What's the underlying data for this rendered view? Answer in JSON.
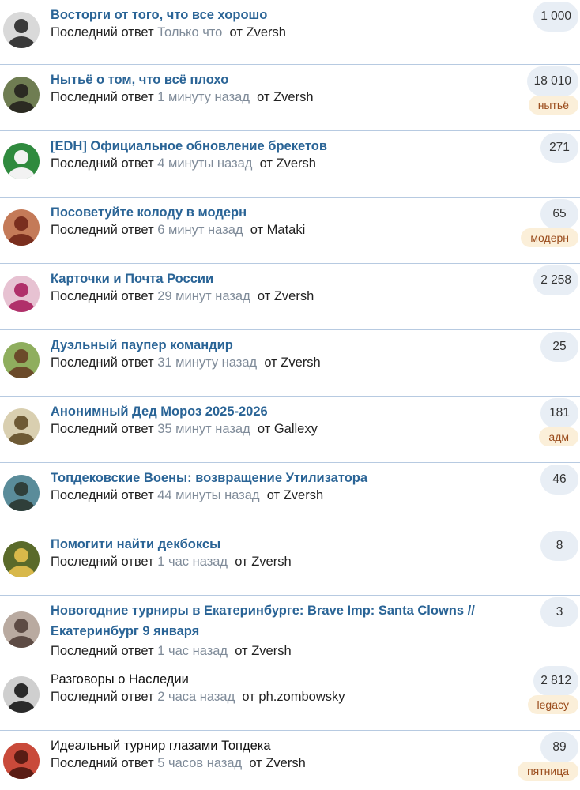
{
  "topics": [
    {
      "title": "Восторги от того, что все хорошо",
      "reply_prefix": "Последний ответ",
      "time": "Только что",
      "by": "от",
      "author": "Zversh",
      "count": "1 000",
      "tag": null,
      "bold": true,
      "avatar": "avatar-a"
    },
    {
      "title": "Нытьё о том, что всё плохо",
      "reply_prefix": "Последний ответ",
      "time": "1 минуту назад",
      "by": "от",
      "author": "Zversh",
      "count": "18 010",
      "tag": "нытьё",
      "bold": true,
      "avatar": "avatar-b"
    },
    {
      "title": "[EDH] Официальное обновление брекетов",
      "reply_prefix": "Последний ответ",
      "time": "4 минуты назад",
      "by": "от",
      "author": "Zversh",
      "count": "271",
      "tag": null,
      "bold": true,
      "avatar": "avatar-c"
    },
    {
      "title": "Посоветуйте колоду в модерн",
      "reply_prefix": "Последний ответ",
      "time": "6 минут назад",
      "by": "от",
      "author": "Mataki",
      "count": "65",
      "tag": "модерн",
      "bold": true,
      "avatar": "avatar-d"
    },
    {
      "title": "Карточки и Почта России",
      "reply_prefix": "Последний ответ",
      "time": "29 минут назад",
      "by": "от",
      "author": "Zversh",
      "count": "2 258",
      "tag": null,
      "bold": true,
      "avatar": "avatar-e"
    },
    {
      "title": "Дуэльный паупер командир",
      "reply_prefix": "Последний ответ",
      "time": "31 минуту назад",
      "by": "от",
      "author": "Zversh",
      "count": "25",
      "tag": null,
      "bold": true,
      "avatar": "avatar-f"
    },
    {
      "title": "Анонимный Дед Мороз 2025-2026",
      "reply_prefix": "Последний ответ",
      "time": "35 минут назад",
      "by": "от",
      "author": "Gallexy",
      "count": "181",
      "tag": "адм",
      "bold": true,
      "avatar": "avatar-g"
    },
    {
      "title": "Топдековские Воены: возвращение Утилизатора",
      "reply_prefix": "Последний ответ",
      "time": "44 минуты назад",
      "by": "от",
      "author": "Zversh",
      "count": "46",
      "tag": null,
      "bold": true,
      "avatar": "avatar-h"
    },
    {
      "title": "Помогити найти декбоксы",
      "reply_prefix": "Последний ответ",
      "time": "1 час назад",
      "by": "от",
      "author": "Zversh",
      "count": "8",
      "tag": null,
      "bold": true,
      "avatar": "avatar-i"
    },
    {
      "title": "Новогодние турниры в Екатеринбурге: Brave Imp: Santa Clowns // Екатеринбург 9 января",
      "reply_prefix": "Последний ответ",
      "time": "1 час назад",
      "by": "от",
      "author": "Zversh",
      "count": "3",
      "tag": null,
      "bold": true,
      "avatar": "avatar-j"
    },
    {
      "title": "Разговоры о Наследии",
      "reply_prefix": "Последний ответ",
      "time": "2 часа назад",
      "by": "от",
      "author": "ph.zombowsky",
      "count": "2 812",
      "tag": "legacy",
      "bold": false,
      "avatar": "avatar-k"
    },
    {
      "title": "Идеальный турнир глазами Топдека",
      "reply_prefix": "Последний ответ",
      "time": "5 часов назад",
      "by": "от",
      "author": "Zversh",
      "count": "89",
      "tag": "пятница",
      "bold": false,
      "avatar": "avatar-l"
    }
  ],
  "avatar_colors": {
    "avatar-a": [
      "#d9d9d9",
      "#3a3a3a"
    ],
    "avatar-b": [
      "#6f7d52",
      "#2b2a22"
    ],
    "avatar-c": [
      "#2f8a3e",
      "#f2f2f2"
    ],
    "avatar-d": [
      "#c47a58",
      "#7a2e1e"
    ],
    "avatar-e": [
      "#e7c2d2",
      "#b0306a"
    ],
    "avatar-f": [
      "#8fae5e",
      "#6b4a2a"
    ],
    "avatar-g": [
      "#d9cfb0",
      "#6e5a35"
    ],
    "avatar-h": [
      "#5a8c9a",
      "#2f3f3a"
    ],
    "avatar-i": [
      "#5a6a2a",
      "#d8b84a"
    ],
    "avatar-j": [
      "#b9aaa0",
      "#5d4b44"
    ],
    "avatar-k": [
      "#cfcfcf",
      "#2a2a2a"
    ],
    "avatar-l": [
      "#c94a3a",
      "#5a1c14"
    ]
  }
}
